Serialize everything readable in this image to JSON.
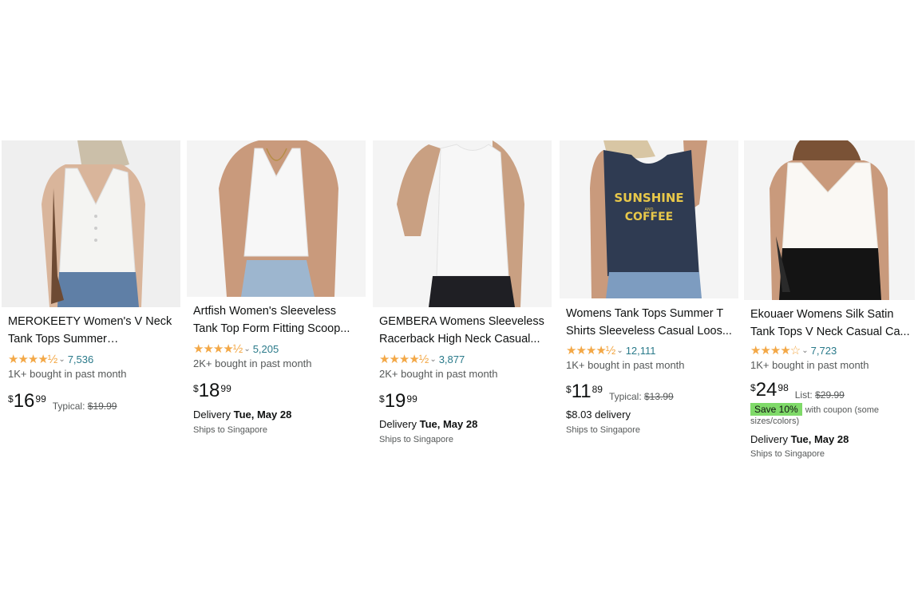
{
  "products": [
    {
      "title": "MEROKEETY Women's V Neck Tank Tops Summer Sleeveless...",
      "stars": "★★★★½",
      "rating_count": "7,536",
      "bought": "1K+ bought in past month",
      "price_symbol": "$",
      "price_whole": "16",
      "price_fraction": "99",
      "typical_label": "Typical:",
      "typical_price": "$19.99",
      "image_icon": "white-vneck-henley-tank-photo",
      "top_color": "#f4f4f2"
    },
    {
      "title": "Artfish Women's Sleeveless Tank Top Form Fitting Scoop...",
      "stars": "★★★★½",
      "rating_count": "5,205",
      "bought": "2K+ bought in past month",
      "price_symbol": "$",
      "price_whole": "18",
      "price_fraction": "99",
      "delivery_label": "Delivery",
      "delivery_date": "Tue, May 28",
      "ships": "Ships to Singapore",
      "image_icon": "white-ribbed-crop-tank-photo",
      "top_color": "#f7f7f7"
    },
    {
      "title": "GEMBERA Womens Sleeveless Racerback High Neck Casual...",
      "stars": "★★★★½",
      "rating_count": "3,877",
      "bought": "2K+ bought in past month",
      "price_symbol": "$",
      "price_whole": "19",
      "price_fraction": "99",
      "delivery_label": "Delivery",
      "delivery_date": "Tue, May 28",
      "ships": "Ships to Singapore",
      "image_icon": "white-racerback-tank-photo",
      "top_color": "#f7f7f7"
    },
    {
      "title": "Womens Tank Tops Summer T Shirts Sleeveless Casual Loos...",
      "stars": "★★★★½",
      "rating_count": "12,111",
      "bought": "1K+ bought in past month",
      "price_symbol": "$",
      "price_whole": "11",
      "price_fraction": "89",
      "typical_label": "Typical:",
      "typical_price": "$13.99",
      "delivery_text": "$8.03 delivery",
      "ships": "Ships to Singapore",
      "image_icon": "navy-sunshine-coffee-tank-photo",
      "top_color": "#2f3b52",
      "graphic_line1": "SUNSHINE",
      "graphic_line2": "AND",
      "graphic_line3": "COFFEE"
    },
    {
      "title": "Ekouaer Womens Silk Satin Tank Tops V Neck Casual Ca...",
      "stars": "★★★★☆",
      "rating_count": "7,723",
      "bought": "1K+ bought in past month",
      "price_symbol": "$",
      "price_whole": "24",
      "price_fraction": "98",
      "typical_label": "List:",
      "typical_price": "$29.99",
      "save_badge": "Save 10%",
      "save_text": "with coupon (some sizes/colors)",
      "delivery_label": "Delivery",
      "delivery_date": "Tue, May 28",
      "ships": "Ships to Singapore",
      "image_icon": "white-satin-vneck-cami-photo",
      "top_color": "#faf8f4"
    }
  ],
  "colors": {
    "star": "#f3a847",
    "link": "#2a7a8a",
    "badge": "#7fda69"
  }
}
